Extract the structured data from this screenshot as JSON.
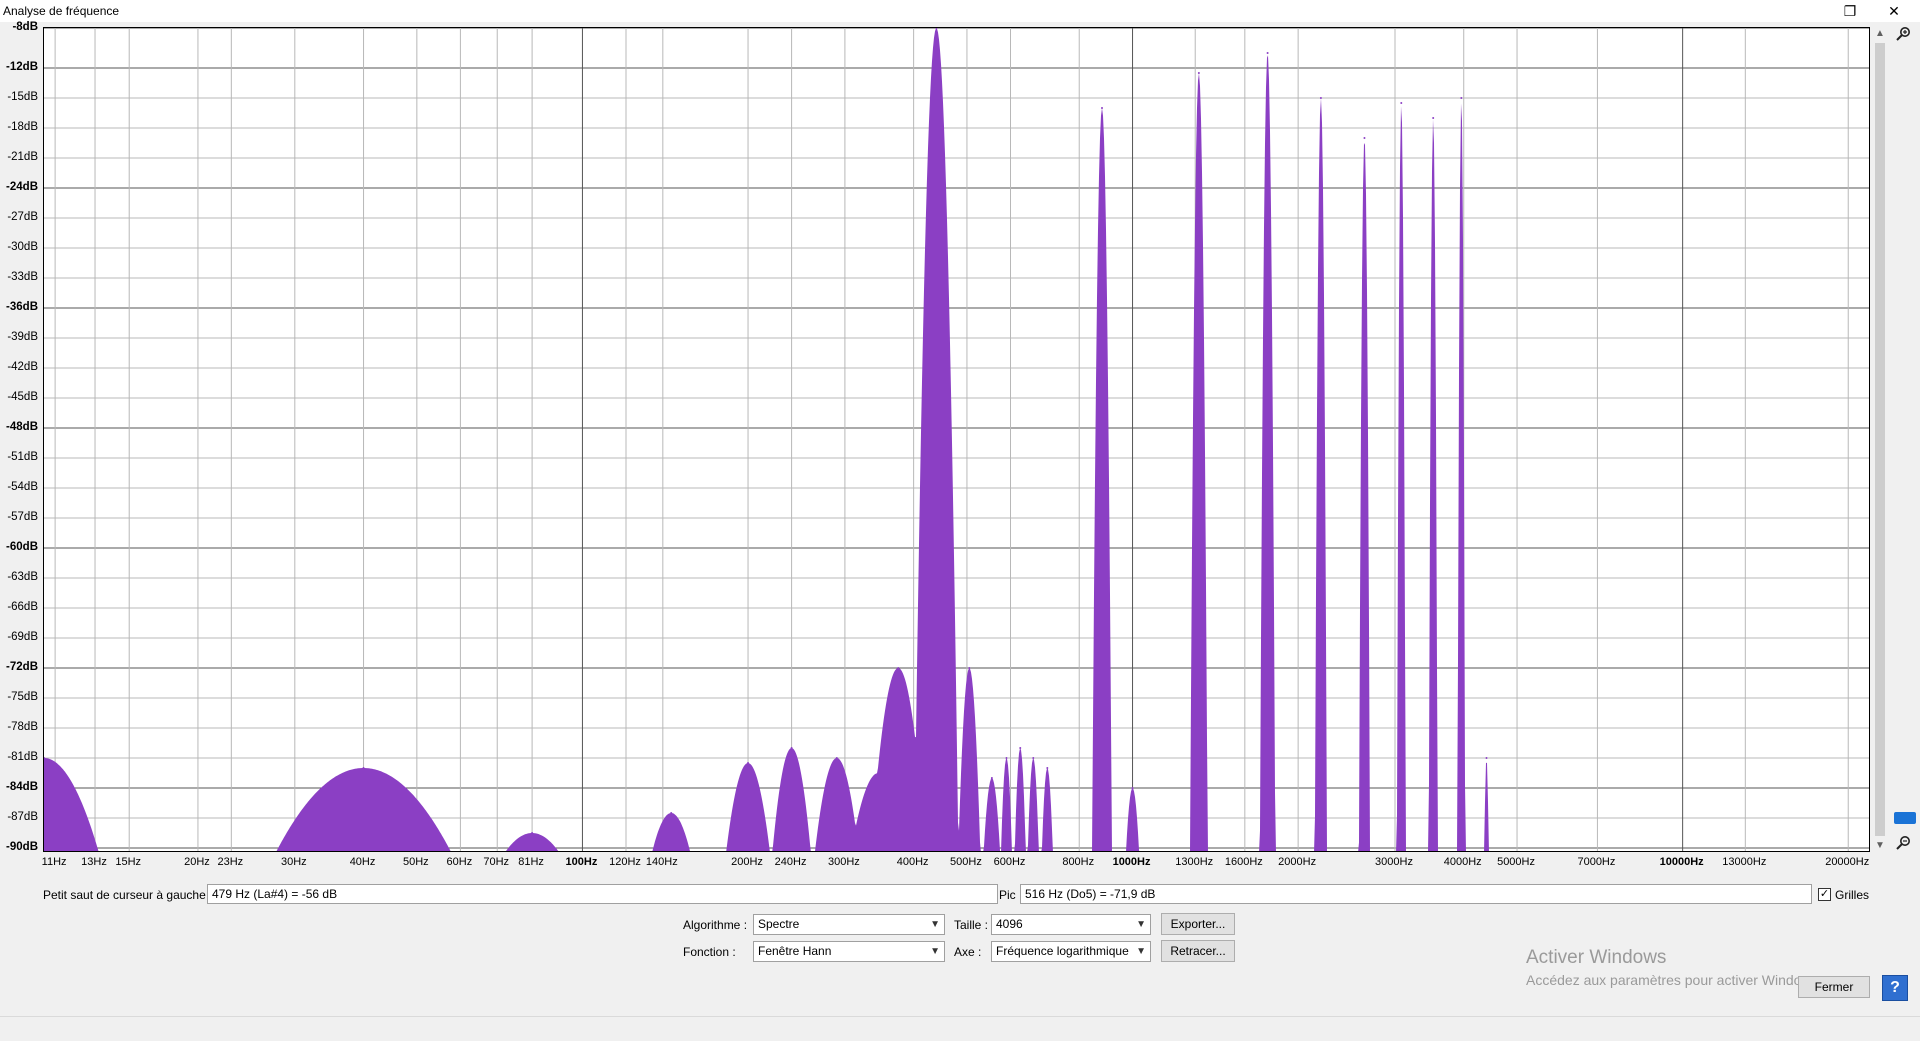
{
  "window": {
    "title": "Analyse de fréquence"
  },
  "chart_data": {
    "type": "area",
    "color": "#8b3fc4",
    "xscale": "log",
    "xlim": [
      10.5,
      22000
    ],
    "ylim": [
      -90.5,
      -8
    ],
    "grid": true,
    "ytick_labels": [
      "-8dB",
      "-12dB",
      "-15dB",
      "-18dB",
      "-21dB",
      "-24dB",
      "-27dB",
      "-30dB",
      "-33dB",
      "-36dB",
      "-39dB",
      "-42dB",
      "-45dB",
      "-48dB",
      "-51dB",
      "-54dB",
      "-57dB",
      "-60dB",
      "-63dB",
      "-66dB",
      "-69dB",
      "-72dB",
      "-75dB",
      "-78dB",
      "-81dB",
      "-84dB",
      "-87dB",
      "-90dB"
    ],
    "ytick_values": [
      -8,
      -12,
      -15,
      -18,
      -21,
      -24,
      -27,
      -30,
      -33,
      -36,
      -39,
      -42,
      -45,
      -48,
      -51,
      -54,
      -57,
      -60,
      -63,
      -66,
      -69,
      -72,
      -75,
      -78,
      -81,
      -84,
      -87,
      -90
    ],
    "ytick_bold": [
      -8,
      -12,
      -24,
      -36,
      -48,
      -60,
      -72,
      -84,
      -90
    ],
    "xtick_labels": [
      "11Hz",
      "13Hz",
      "15Hz",
      "20Hz",
      "23Hz",
      "30Hz",
      "40Hz",
      "50Hz",
      "60Hz",
      "70Hz",
      "81Hz",
      "100Hz",
      "120Hz",
      "140Hz",
      "200Hz",
      "240Hz",
      "300Hz",
      "400Hz",
      "500Hz",
      "600Hz",
      "800Hz",
      "1000Hz",
      "1300Hz",
      "1600Hz",
      "2000Hz",
      "3000Hz",
      "4000Hz",
      "5000Hz",
      "7000Hz",
      "10000Hz",
      "13000Hz",
      "20000Hz"
    ],
    "xtick_values": [
      11,
      13,
      15,
      20,
      23,
      30,
      40,
      50,
      60,
      70,
      81,
      100,
      120,
      140,
      200,
      240,
      300,
      400,
      500,
      600,
      800,
      1000,
      1300,
      1600,
      2000,
      3000,
      4000,
      5000,
      7000,
      10000,
      13000,
      20000
    ],
    "xtick_bold": [
      100,
      1000,
      10000
    ],
    "peaks": [
      {
        "freq": 10.5,
        "db": -81,
        "width": 0.1
      },
      {
        "freq": 40,
        "db": -82,
        "width": 0.16
      },
      {
        "freq": 81,
        "db": -88.5,
        "width": 0.05
      },
      {
        "freq": 145,
        "db": -86.5,
        "width": 0.035
      },
      {
        "freq": 200,
        "db": -81.5,
        "width": 0.04
      },
      {
        "freq": 240,
        "db": -80,
        "width": 0.035
      },
      {
        "freq": 290,
        "db": -81,
        "width": 0.04
      },
      {
        "freq": 345,
        "db": -82.5,
        "width": 0.05
      },
      {
        "freq": 375,
        "db": -72,
        "width": 0.05
      },
      {
        "freq": 440,
        "db": -8,
        "width": 0.04
      },
      {
        "freq": 505,
        "db": -72,
        "width": 0.02
      },
      {
        "freq": 555,
        "db": -83,
        "width": 0.015
      },
      {
        "freq": 590,
        "db": -81,
        "width": 0.01
      },
      {
        "freq": 625,
        "db": -80,
        "width": 0.01
      },
      {
        "freq": 660,
        "db": -81,
        "width": 0.01
      },
      {
        "freq": 700,
        "db": -82,
        "width": 0.01
      },
      {
        "freq": 880,
        "db": -16,
        "width": 0.018
      },
      {
        "freq": 1000,
        "db": -84,
        "width": 0.012
      },
      {
        "freq": 1320,
        "db": -12.5,
        "width": 0.016
      },
      {
        "freq": 1760,
        "db": -10.5,
        "width": 0.014
      },
      {
        "freq": 2200,
        "db": -15,
        "width": 0.011
      },
      {
        "freq": 2640,
        "db": -19,
        "width": 0.01
      },
      {
        "freq": 3080,
        "db": -15.5,
        "width": 0.008
      },
      {
        "freq": 3520,
        "db": -17,
        "width": 0.008
      },
      {
        "freq": 3960,
        "db": -15,
        "width": 0.007
      },
      {
        "freq": 4400,
        "db": -81,
        "width": 0.004
      }
    ]
  },
  "cursor": {
    "label": "Petit saut de curseur à gauche :",
    "value": "479 Hz (La#4) = -56 dB"
  },
  "peak": {
    "label": "Pic :",
    "value": "516 Hz (Do5) = -71,9 dB"
  },
  "grids": {
    "label": "Grilles",
    "checked": true
  },
  "algorithm": {
    "label": "Algorithme :",
    "value": "Spectre"
  },
  "size": {
    "label": "Taille :",
    "value": "4096"
  },
  "function": {
    "label": "Fonction :",
    "value": "Fenêtre Hann"
  },
  "axis": {
    "label": "Axe :",
    "value": "Fréquence logarithmique"
  },
  "buttons": {
    "export": "Exporter...",
    "replot": "Retracer...",
    "close": "Fermer",
    "help": "?"
  },
  "watermark": {
    "line1": "Activer Windows",
    "line2": "Accédez aux paramètres pour activer Windows."
  },
  "icons": {
    "zoom_in": "zoom-in-icon",
    "zoom_out": "zoom-out-icon",
    "maximize": "restore-icon",
    "close": "close-icon"
  }
}
